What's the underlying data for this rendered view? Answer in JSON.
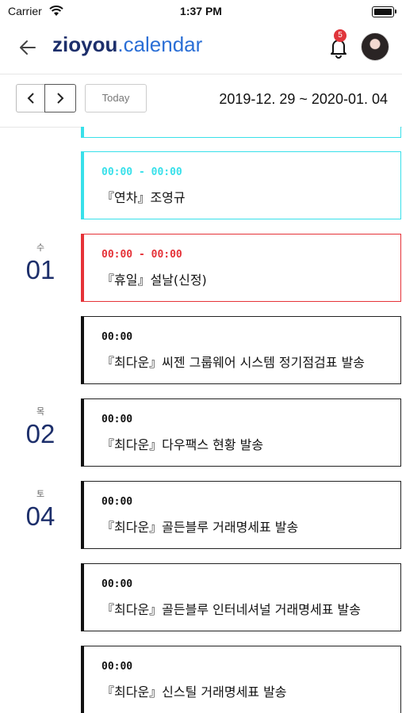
{
  "status_bar": {
    "carrier": "Carrier",
    "time": "1:37 PM"
  },
  "header": {
    "logo_bold": "zioyou",
    "logo_light": ".calendar",
    "notification_count": "5"
  },
  "toolbar": {
    "today_label": "Today",
    "date_range": "2019-12. 29 ~ 2020-01. 04"
  },
  "days": [
    {
      "weekday": "수",
      "date": "01"
    },
    {
      "weekday": "목",
      "date": "02"
    },
    {
      "weekday": "토",
      "date": "04"
    }
  ],
  "events": [
    {
      "time": "00:00 - 00:00",
      "title": "『연차』조영규",
      "color": "#38e0ea"
    },
    {
      "time": "00:00 - 00:00",
      "title": "『휴일』설날(신정)",
      "color": "#e53238"
    },
    {
      "time": "00:00",
      "title": "『최다운』씨젠 그룹웨어 시스템 정기점검표 발송",
      "color": "#111111"
    },
    {
      "time": "00:00",
      "title": "『최다운』다우팩스 현황 발송",
      "color": "#111111"
    },
    {
      "time": "00:00",
      "title": "『최다운』골든블루 거래명세표 발송",
      "color": "#111111"
    },
    {
      "time": "00:00",
      "title": "『최다운』골든블루 인터네셔널 거래명세표 발송",
      "color": "#111111"
    },
    {
      "time": "00:00",
      "title": "『최다운』신스틸 거래명세표 발송",
      "color": "#111111"
    }
  ]
}
